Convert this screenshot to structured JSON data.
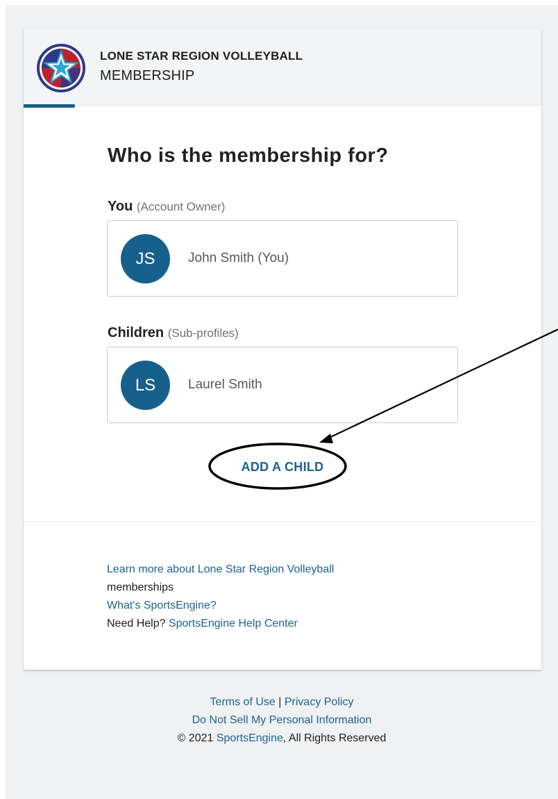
{
  "header": {
    "org_name": "LONE STAR REGION VOLLEYBALL",
    "subtitle": "MEMBERSHIP",
    "logo_icon": "lone-star-region-logo"
  },
  "main": {
    "question": "Who is the membership for?",
    "you_section": {
      "label": "You",
      "sub_label": "(Account Owner)",
      "profile": {
        "initials": "JS",
        "name": "John Smith (You)"
      }
    },
    "children_section": {
      "label": "Children",
      "sub_label": "(Sub-profiles)",
      "profiles": [
        {
          "initials": "LS",
          "name": "Laurel Smith"
        }
      ]
    },
    "add_child_label": "ADD A CHILD"
  },
  "card_footer": {
    "learn_more_link": "Learn more about Lone Star Region Volleyball",
    "learn_more_tail": "memberships",
    "whats_link": "What's SportsEngine?",
    "help_prefix": "Need Help?",
    "help_link": "SportsEngine Help Center"
  },
  "page_footer": {
    "terms_link": "Terms of Use",
    "separator": "|",
    "privacy_link": "Privacy Policy",
    "do_not_sell_link": "Do Not Sell My Personal Information",
    "copyright_prefix": "© 2021",
    "copyright_link": "SportsEngine",
    "copyright_suffix": ", All Rights Reserved"
  },
  "colors": {
    "accent": "#17608c",
    "link": "#1b6390",
    "page_bg": "#f0f1f2"
  }
}
